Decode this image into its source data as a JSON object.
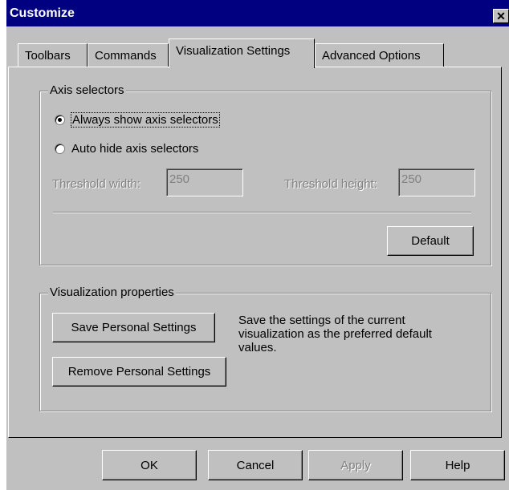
{
  "window": {
    "title": "Customize",
    "close_glyph": "✕"
  },
  "tabs": [
    {
      "label": "Toolbars",
      "active": false
    },
    {
      "label": "Commands",
      "active": false
    },
    {
      "label": "Visualization Settings",
      "active": true
    },
    {
      "label": "Advanced Options",
      "active": false
    }
  ],
  "axis_selectors": {
    "legend": "Axis selectors",
    "options": [
      {
        "label": "Always show axis selectors",
        "checked": true
      },
      {
        "label": "Auto hide axis selectors",
        "checked": false
      }
    ],
    "threshold_width_label": "Threshold width:",
    "threshold_width_value": "250",
    "threshold_height_label": "Threshold height:",
    "threshold_height_value": "250",
    "default_button": "Default"
  },
  "visualization_properties": {
    "legend": "Visualization properties",
    "save_button": "Save Personal Settings",
    "remove_button": "Remove Personal Settings",
    "description_lines": [
      "Save the settings of the current",
      "visualization as the preferred default",
      "values."
    ]
  },
  "footer": {
    "ok": "OK",
    "cancel": "Cancel",
    "apply": "Apply",
    "help": "Help"
  },
  "colors": {
    "titlebar": "#000080",
    "face": "#c0c0c0",
    "disabled_text": "#808080"
  }
}
